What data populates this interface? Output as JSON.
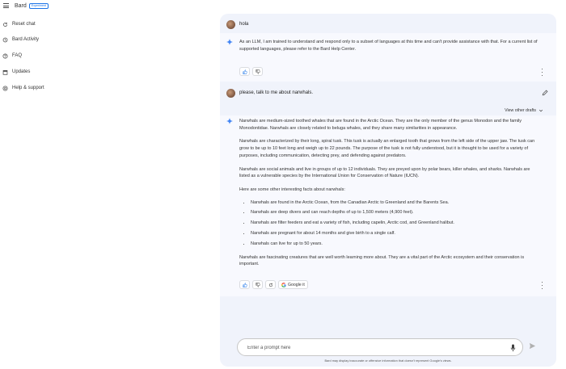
{
  "app": {
    "name": "Bard",
    "badge": "Experiment"
  },
  "sidebar": {
    "items": [
      {
        "label": "Reset chat",
        "icon": "reset-icon"
      },
      {
        "label": "Bard Activity",
        "icon": "history-icon"
      },
      {
        "label": "FAQ",
        "icon": "help-icon"
      },
      {
        "label": "Updates",
        "icon": "calendar-icon"
      },
      {
        "label": "Help & support",
        "icon": "support-icon"
      }
    ]
  },
  "conversation": {
    "turn1": {
      "prompt": "hola",
      "response": "As an LLM, I am trained to understand and respond only to a subset of languages at this time and can't provide assistance with that. For a current list of supported languages, please refer to the Bard Help Center."
    },
    "turn2": {
      "prompt": "please, talk to me about narwhals.",
      "view_drafts": "View other drafts",
      "paragraphs": [
        "Narwhals are medium-sized toothed whales that are found in the Arctic Ocean. They are the only member of the genus Monodon and the family Monodontidae. Narwhals are closely related to beluga whales, and they share many similarities in appearance.",
        "Narwhals are characterized by their long, spiral tusk. This tusk is actually an enlarged tooth that grows from the left side of the upper jaw. The tusk can grow to be up to 10 feet long and weigh up to 22 pounds. The purpose of the tusk is not fully understood, but it is thought to be used for a variety of purposes, including communication, detecting prey, and defending against predators.",
        "Narwhals are social animals and live in groups of up to 12 individuals. They are preyed upon by polar bears, killer whales, and sharks. Narwhals are listed as a vulnerable species by the International Union for Conservation of Nature (IUCN).",
        "Here are some other interesting facts about narwhals:"
      ],
      "facts": [
        "Narwhals are found in the Arctic Ocean, from the Canadian Arctic to Greenland and the Barents Sea.",
        "Narwhals are deep divers and can reach depths of up to 1,500 meters (4,900 feet).",
        "Narwhals are filter feeders and eat a variety of fish, including capelin, Arctic cod, and Greenland halibut.",
        "Narwhals are pregnant for about 14 months and give birth to a single calf.",
        "Narwhals can live for up to 50 years."
      ],
      "closing": "Narwhals are fascinating creatures that are well worth learning more about. They are a vital part of the Arctic ecosystem and their conservation is important.",
      "google_it": "Google it"
    }
  },
  "input": {
    "placeholder": "Enter a prompt here",
    "disclaimer": "Bard may display inaccurate or offensive information that doesn't represent Google's views."
  },
  "colors": {
    "panel": "#f0f3fb",
    "accent": "#1a73e8"
  }
}
